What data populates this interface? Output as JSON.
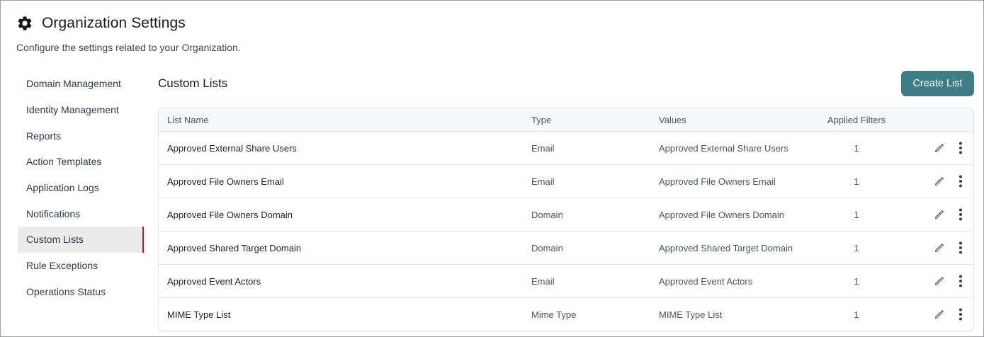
{
  "header": {
    "title": "Organization Settings",
    "subtitle": "Configure the settings related to your Organization.",
    "icon": "gear-icon"
  },
  "sidebar": {
    "items": [
      {
        "label": "Domain Management",
        "active": false
      },
      {
        "label": "Identity Management",
        "active": false
      },
      {
        "label": "Reports",
        "active": false
      },
      {
        "label": "Action Templates",
        "active": false
      },
      {
        "label": "Application Logs",
        "active": false
      },
      {
        "label": "Notifications",
        "active": false
      },
      {
        "label": "Custom Lists",
        "active": true
      },
      {
        "label": "Rule Exceptions",
        "active": false
      },
      {
        "label": "Operations Status",
        "active": false
      }
    ]
  },
  "main": {
    "section_title": "Custom Lists",
    "create_button_label": "Create List",
    "table": {
      "columns": [
        "List Name",
        "Type",
        "Values",
        "Applied Filters"
      ],
      "rows": [
        {
          "name": "Approved External Share Users",
          "type": "Email",
          "values": "Approved External Share Users",
          "filters": "1"
        },
        {
          "name": "Approved File Owners Email",
          "type": "Email",
          "values": "Approved File Owners Email",
          "filters": "1"
        },
        {
          "name": "Approved File Owners Domain",
          "type": "Domain",
          "values": "Approved File Owners Domain",
          "filters": "1"
        },
        {
          "name": "Approved Shared Target Domain",
          "type": "Domain",
          "values": "Approved Shared Target Domain",
          "filters": "1"
        },
        {
          "name": "Approved Event Actors",
          "type": "Email",
          "values": "Approved Event Actors",
          "filters": "1"
        },
        {
          "name": "MIME Type List",
          "type": "Mime Type",
          "values": "MIME Type List",
          "filters": "1"
        }
      ],
      "row_actions": [
        "pencil-icon",
        "more-vertical-icon"
      ]
    }
  },
  "colors": {
    "accent": "#3f7d86",
    "active_indicator": "#c8102e",
    "active_bg": "#ebebeb"
  }
}
